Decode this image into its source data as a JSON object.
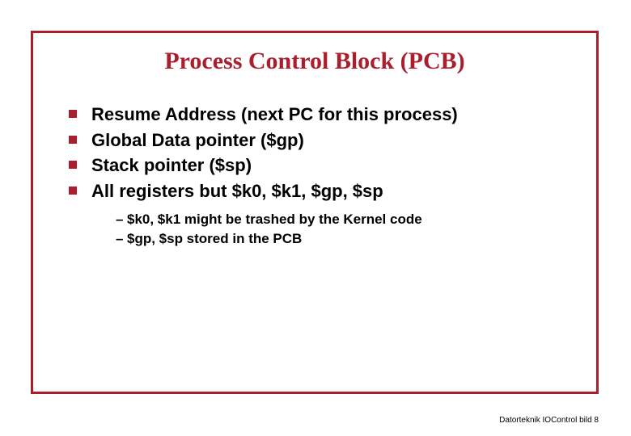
{
  "title": "Process Control Block (PCB)",
  "bullets": [
    "Resume Address (next PC for this process)",
    "Global Data pointer ($gp)",
    "Stack pointer ($sp)",
    "All registers but $k0, $k1, $gp, $sp"
  ],
  "subbullets": [
    "$k0, $k1 might be trashed by the Kernel code",
    "$gp, $sp stored in the PCB"
  ],
  "footer": "Datorteknik IOControl bild 8"
}
